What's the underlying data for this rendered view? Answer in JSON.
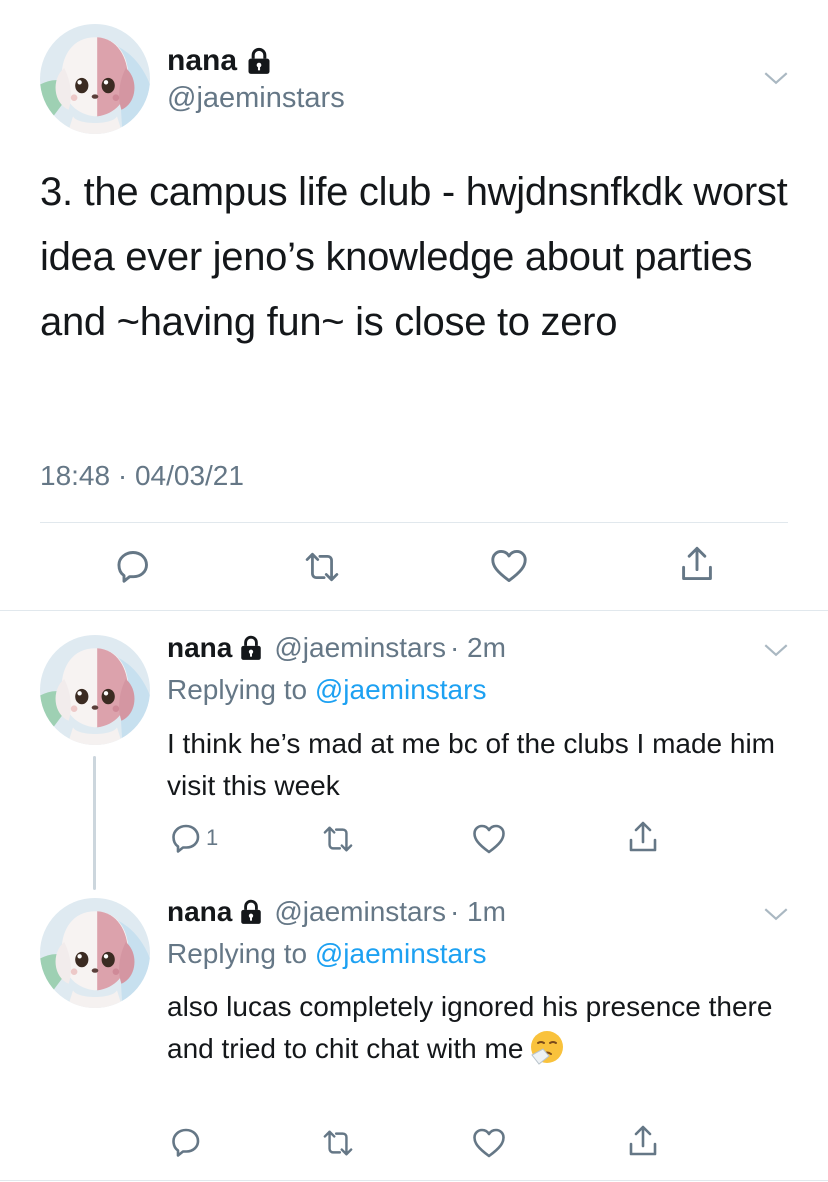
{
  "main_tweet": {
    "display_name": "nana",
    "handle": "@jaeminstars",
    "text": "3. the campus life club - hwjdnsnfkdk worst idea ever jeno’s knowledge about parties and ~having fun~ is close to zero",
    "timestamp": "18:48 · 04/03/21"
  },
  "replies": [
    {
      "display_name": "nana",
      "handle": "@jaeminstars",
      "time": "· 2m",
      "replying_prefix": "Replying to ",
      "replying_to": "@jaeminstars",
      "text": "I think he’s mad at me bc of the clubs I made him visit this week",
      "reply_count": "1"
    },
    {
      "display_name": "nana",
      "handle": "@jaeminstars",
      "time": "· 1m",
      "replying_prefix": "Replying to ",
      "replying_to": "@jaeminstars",
      "text": "also lucas completely ignored his presence there and tried to chit chat with me",
      "emoji": "sneezing-face-emoji"
    }
  ],
  "colors": {
    "text": "#14171a",
    "secondary": "#657786",
    "link": "#1da1f2",
    "divider": "#e1e8ed",
    "icon": "#657786"
  },
  "icons": [
    "lock-icon",
    "chevron-down-icon",
    "reply-icon",
    "retweet-icon",
    "like-icon",
    "share-icon"
  ]
}
